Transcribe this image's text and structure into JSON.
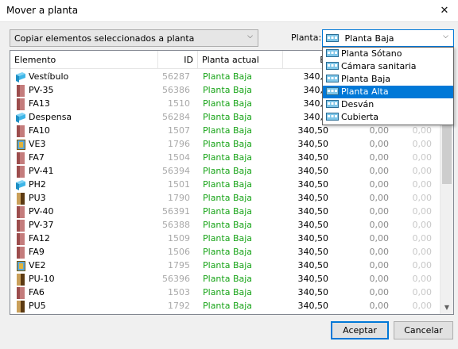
{
  "window": {
    "title": "Mover a planta",
    "close_glyph": "✕"
  },
  "mode_select": {
    "value": "Copiar elementos seleccionados a planta"
  },
  "planta": {
    "label": "Planta:",
    "value": "Planta Baja"
  },
  "dropdown": {
    "options": [
      "Planta Sótano",
      "Cámara sanitaria",
      "Planta Baja",
      "Planta Alta",
      "Desván",
      "Cubierta"
    ],
    "selected": "Planta Alta"
  },
  "table": {
    "columns": [
      "Elemento",
      "ID",
      "Planta actual",
      "E ("
    ],
    "rows": [
      {
        "icon": "room-icon",
        "name": "Vestíbulo",
        "id": "56287",
        "planta": "Planta Baja",
        "e": "340,5",
        "f": "",
        "g": ""
      },
      {
        "icon": "wall-icon",
        "name": "PV-35",
        "id": "56386",
        "planta": "Planta Baja",
        "e": "340,5",
        "f": "",
        "g": ""
      },
      {
        "icon": "wall-icon",
        "name": "FA13",
        "id": "1510",
        "planta": "Planta Baja",
        "e": "340,5",
        "f": "",
        "g": ""
      },
      {
        "icon": "room-icon",
        "name": "Despensa",
        "id": "56284",
        "planta": "Planta Baja",
        "e": "340,5",
        "f": "",
        "g": ""
      },
      {
        "icon": "wall-icon",
        "name": "FA10",
        "id": "1507",
        "planta": "Planta Baja",
        "e": "340,50",
        "f": "0,00",
        "g": "0,00"
      },
      {
        "icon": "window-icon",
        "name": "VE3",
        "id": "1796",
        "planta": "Planta Baja",
        "e": "340,50",
        "f": "0,00",
        "g": "0,00"
      },
      {
        "icon": "wall-icon",
        "name": "FA7",
        "id": "1504",
        "planta": "Planta Baja",
        "e": "340,50",
        "f": "0,00",
        "g": "0,00"
      },
      {
        "icon": "wall-icon",
        "name": "PV-41",
        "id": "56394",
        "planta": "Planta Baja",
        "e": "340,50",
        "f": "0,00",
        "g": "0,00"
      },
      {
        "icon": "room-icon",
        "name": "PH2",
        "id": "1501",
        "planta": "Planta Baja",
        "e": "340,50",
        "f": "0,00",
        "g": "0,00"
      },
      {
        "icon": "door-icon",
        "name": "PU3",
        "id": "1790",
        "planta": "Planta Baja",
        "e": "340,50",
        "f": "0,00",
        "g": "0,00"
      },
      {
        "icon": "wall-icon",
        "name": "PV-40",
        "id": "56391",
        "planta": "Planta Baja",
        "e": "340,50",
        "f": "0,00",
        "g": "0,00"
      },
      {
        "icon": "wall-icon",
        "name": "PV-37",
        "id": "56388",
        "planta": "Planta Baja",
        "e": "340,50",
        "f": "0,00",
        "g": "0,00"
      },
      {
        "icon": "wall-icon",
        "name": "FA12",
        "id": "1509",
        "planta": "Planta Baja",
        "e": "340,50",
        "f": "0,00",
        "g": "0,00"
      },
      {
        "icon": "wall-icon",
        "name": "FA9",
        "id": "1506",
        "planta": "Planta Baja",
        "e": "340,50",
        "f": "0,00",
        "g": "0,00"
      },
      {
        "icon": "window-icon",
        "name": "VE2",
        "id": "1795",
        "planta": "Planta Baja",
        "e": "340,50",
        "f": "0,00",
        "g": "0,00"
      },
      {
        "icon": "door-icon",
        "name": "PU-10",
        "id": "56396",
        "planta": "Planta Baja",
        "e": "340,50",
        "f": "0,00",
        "g": "0,00"
      },
      {
        "icon": "wall-icon",
        "name": "FA6",
        "id": "1503",
        "planta": "Planta Baja",
        "e": "340,50",
        "f": "0,00",
        "g": "0,00"
      },
      {
        "icon": "door-icon",
        "name": "PU5",
        "id": "1792",
        "planta": "Planta Baja",
        "e": "340,50",
        "f": "0,00",
        "g": "0,00"
      }
    ]
  },
  "buttons": {
    "ok": "Aceptar",
    "cancel": "Cancelar"
  },
  "colors": {
    "accent": "#0078d7",
    "planta_text": "#18a418",
    "wall": "#9c4d4d",
    "room": "#3fb6e8"
  }
}
